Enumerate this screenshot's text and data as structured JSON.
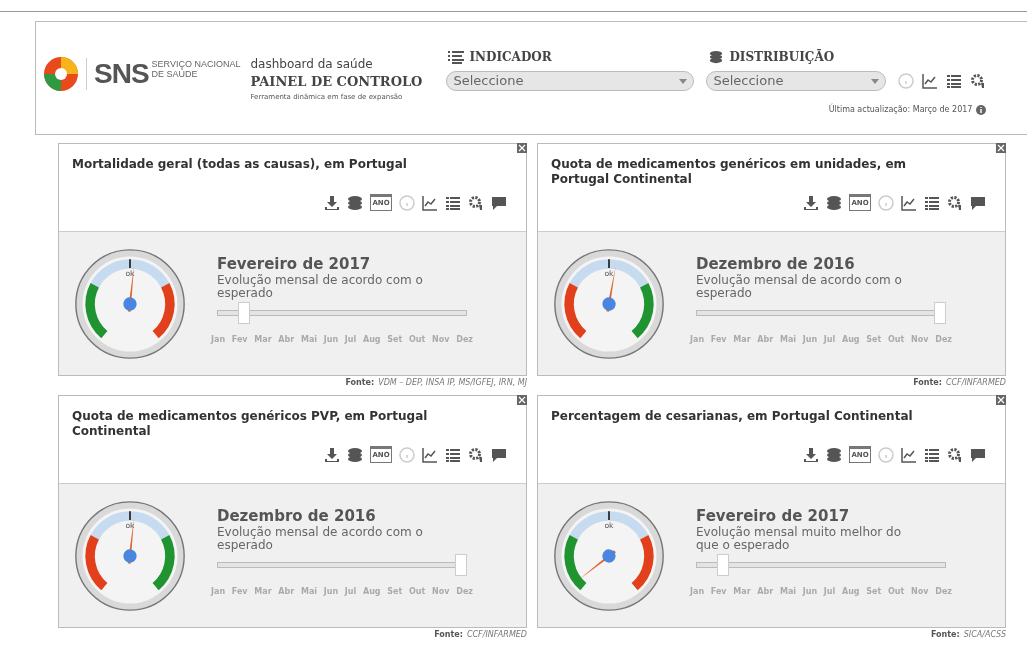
{
  "header": {
    "logo_text": "SNS",
    "logo_sub": [
      "SERVIÇO NACIONAL",
      "DE SAÚDE"
    ],
    "subtitle": "dashboard da saúde",
    "title": "PAINEL DE CONTROLO",
    "tagline": "Ferramenta dinâmica em fase de expansão",
    "selects": [
      {
        "label": "INDICADOR",
        "kind": "list",
        "placeholder": "Seleccione"
      },
      {
        "label": "DISTRIBUIÇÃO",
        "kind": "layers",
        "placeholder": "Seleccione"
      }
    ],
    "last_update": "Última actualização: Março de 2017"
  },
  "cards": [
    {
      "title": "Mortalidade geral (todas as causas), em Portugal",
      "calendar_label": "ANO",
      "gauge_label": "ok",
      "kind": "green-left",
      "period": "Fevereiro de 2017",
      "status": "Evolução mensal de acordo com o esperado",
      "slider": {
        "level": 0.09
      },
      "months": [
        "Jan",
        "Fev",
        "Mar",
        "Abr",
        "Mai",
        "Jun",
        "Jul",
        "Aug",
        "Set",
        "Out",
        "Nov",
        "Dez"
      ],
      "source_label": "Fonte:",
      "source": "VDM – DEP, INSA IP, MS/IGFEJ, IRN, MJ"
    },
    {
      "title": "Quota de medicamentos genéricos em unidades, em Portugal Continental",
      "calendar_label": "ANO",
      "gauge_label": "ok",
      "kind": "red-left",
      "period": "Dezembro de 2016",
      "status": "Evolução mensal de acordo com o esperado",
      "slider": {
        "level": 1
      },
      "months": [
        "Jan",
        "Fev",
        "Mar",
        "Abr",
        "Mai",
        "Jun",
        "Jul",
        "Aug",
        "Set",
        "Out",
        "Nov",
        "Dez"
      ],
      "source_label": "Fonte:",
      "source": "CCF/INFARMED"
    },
    {
      "title": "Quota de medicamentos genéricos PVP, em Portugal Continental",
      "calendar_label": "ANO",
      "gauge_label": "ok",
      "kind": "red-left",
      "period": "Dezembro de 2016",
      "status": "Evolução mensal de acordo com o esperado",
      "slider": {
        "level": 1
      },
      "months": [
        "Jan",
        "Fev",
        "Mar",
        "Abr",
        "Mai",
        "Jun",
        "Jul",
        "Aug",
        "Set",
        "Out",
        "Nov",
        "Dez"
      ],
      "source_label": "Fonte:",
      "source": "CCF/INFARMED"
    },
    {
      "title": "Percentagem de cesarianas, em Portugal Continental",
      "calendar_label": "ANO",
      "gauge_label": "ok",
      "kind": "green-left",
      "period": "Fevereiro de 2017",
      "status": "Evolução mensal muito melhor do que o esperado",
      "slider": {
        "level": 0.09
      },
      "months": [
        "Jan",
        "Fev",
        "Mar",
        "Abr",
        "Mai",
        "Jun",
        "Jul",
        "Aug",
        "Set",
        "Out",
        "Nov",
        "Dez"
      ],
      "source_label": "Fonte:",
      "source": "SICA/ACSS"
    }
  ]
}
